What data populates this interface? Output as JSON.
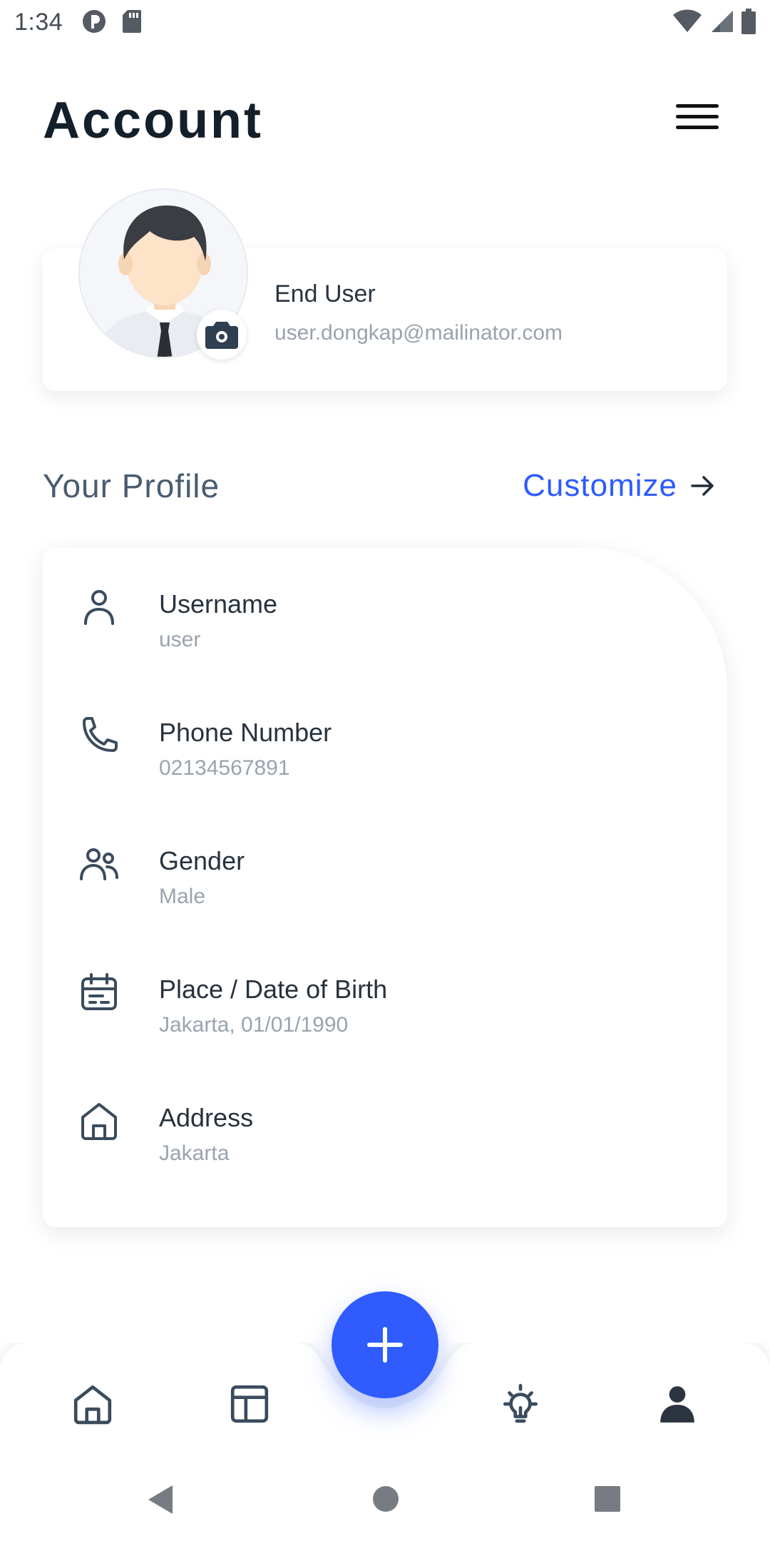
{
  "status_bar": {
    "time": "1:34",
    "icons": [
      "signal-app-icon",
      "sd-card-icon",
      "wifi-icon",
      "cellular-icon",
      "battery-icon"
    ]
  },
  "header": {
    "title": "Account",
    "menu_icon": "hamburger-menu-icon"
  },
  "account": {
    "name": "End User",
    "email": "user.dongkap@mailinator.com",
    "avatar_icon": "user-avatar",
    "camera_icon": "camera-icon"
  },
  "profile_section": {
    "title": "Your Profile",
    "customize_label": "Customize",
    "customize_icon": "arrow-right-icon",
    "items": [
      {
        "label": "Username",
        "value": "user",
        "icon": "person-icon"
      },
      {
        "label": "Phone Number",
        "value": "02134567891",
        "icon": "phone-icon"
      },
      {
        "label": "Gender",
        "value": "Male",
        "icon": "people-icon"
      },
      {
        "label": "Place / Date of Birth",
        "value": "Jakarta, 01/01/1990",
        "icon": "calendar-icon"
      },
      {
        "label": "Address",
        "value": "Jakarta",
        "icon": "home-icon"
      }
    ]
  },
  "bottom_nav": {
    "items": [
      "home-icon",
      "layout-icon",
      "add-icon",
      "lightbulb-icon",
      "profile-icon"
    ],
    "active": "profile-icon"
  },
  "system_nav": {
    "items": [
      "back-icon",
      "home-circle-icon",
      "recents-square-icon"
    ]
  },
  "colors": {
    "accent": "#2e5bff",
    "title": "#13202b",
    "muted": "#9aa3ad",
    "icon": "#3a4b5c"
  }
}
